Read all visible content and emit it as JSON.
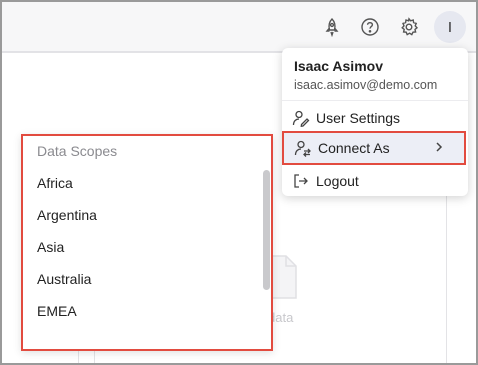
{
  "header": {
    "icons": [
      "rocket-icon",
      "help-icon",
      "gear-icon"
    ],
    "avatar_initial": "I"
  },
  "background": {
    "partial_text": ":",
    "empty_label": "data"
  },
  "data_scopes": {
    "title": "Data Scopes",
    "items": [
      "Africa",
      "Argentina",
      "Asia",
      "Australia",
      "EMEA"
    ]
  },
  "user_menu": {
    "name": "Isaac Asimov",
    "email": "isaac.asimov@demo.com",
    "items": [
      {
        "label": "User Settings",
        "icon": "user-settings-icon"
      },
      {
        "label": "Connect As",
        "icon": "connect-as-icon"
      },
      {
        "label": "Logout",
        "icon": "logout-icon"
      }
    ]
  },
  "colors": {
    "highlight": "#e24b3f",
    "selected_bg": "#eceef6"
  }
}
